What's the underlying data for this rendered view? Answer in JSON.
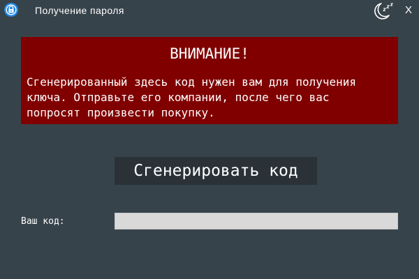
{
  "window": {
    "title": "Получение пароля",
    "close_label": "X",
    "logo_icon": "padlock-ring-icon",
    "sleep_icon": "moon-sleep-icon"
  },
  "warning": {
    "heading": "ВНИМАНИЕ!",
    "text": "Сгенерированный здесь код нужен вам для получения\nключа. Отправьте его компании, после чего вас\nпопросят произвести покупку."
  },
  "generate_button": {
    "label": "Сгенерировать код"
  },
  "code_field": {
    "label": "Ваш код:",
    "value": ""
  },
  "colors": {
    "background": "#37434b",
    "warning_background": "#800000",
    "button_background": "#2a3238",
    "input_background": "#d9d9d9",
    "logo_accent": "#1e88e5",
    "text": "#ffffff"
  }
}
